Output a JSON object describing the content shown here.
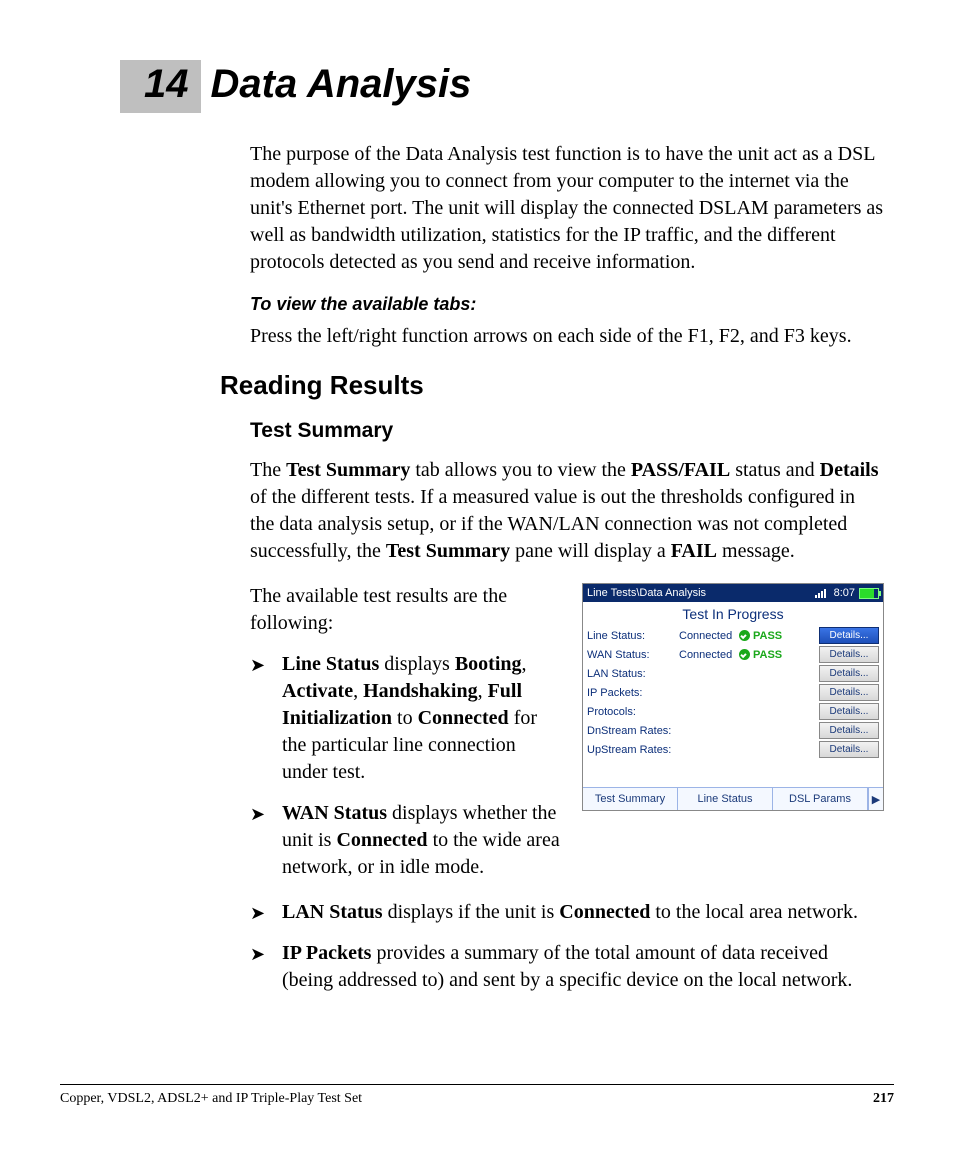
{
  "chapter": {
    "number": "14",
    "title": "Data Analysis"
  },
  "intro": "The purpose of the Data Analysis test function is to have the unit act as a DSL modem allowing you to connect from your computer to the internet via the unit's Ethernet port. The unit will display the connected DSLAM parameters as well as bandwidth utilization, statistics for the IP traffic, and the different protocols detected as you send and receive information.",
  "tabs_heading": "To view the available tabs:",
  "tabs_instruction": "Press the left/right function arrows on each side of the F1, F2, and F3 keys.",
  "h2": "Reading Results",
  "h3": "Test Summary",
  "summary_para_parts": {
    "a": "The ",
    "b": "Test Summary",
    "c": " tab allows you to view the ",
    "d": "PASS/FAIL",
    "e": " status and ",
    "f": "Details",
    "g": " of the different tests. If a measured value is out the thresholds configured in the data analysis setup, or if the WAN/LAN connection was not completed successfully, the ",
    "h": "Test Summary",
    "i": " pane will display a ",
    "j": "FAIL",
    "k": " message."
  },
  "avail_intro": "The available test results are the following:",
  "bullets_wrap": [
    {
      "parts": [
        "",
        "Line Status",
        " displays ",
        "Booting",
        ", ",
        "Activate",
        ", ",
        "Handshaking",
        ", ",
        "Full Initialization",
        " to ",
        "Connected",
        " for the particular line connection under test."
      ]
    },
    {
      "parts": [
        "",
        "WAN Status",
        " displays whether the unit is ",
        "Connected",
        " to the wide area network, or in idle mode."
      ]
    }
  ],
  "bullets_full": [
    {
      "parts": [
        "",
        "LAN Status",
        " displays if the unit is ",
        "Connected",
        " to the local area network."
      ]
    },
    {
      "parts": [
        "",
        "IP Packets",
        " provides a summary of the total amount of data received (being addressed to) and sent by a specific device on the local network."
      ]
    }
  ],
  "device": {
    "breadcrumb": "Line Tests\\Data Analysis",
    "clock": "8:07",
    "header": "Test In Progress",
    "rows": [
      {
        "label": "Line Status:",
        "value": "Connected",
        "pass": "PASS",
        "selected": true
      },
      {
        "label": "WAN Status:",
        "value": "Connected",
        "pass": "PASS",
        "selected": false
      },
      {
        "label": "LAN Status:",
        "value": "",
        "pass": "",
        "selected": false
      },
      {
        "label": "IP Packets:",
        "value": "",
        "pass": "",
        "selected": false
      },
      {
        "label": "Protocols:",
        "value": "",
        "pass": "",
        "selected": false
      },
      {
        "label": "DnStream Rates:",
        "value": "",
        "pass": "",
        "selected": false
      },
      {
        "label": "UpStream Rates:",
        "value": "",
        "pass": "",
        "selected": false
      }
    ],
    "button_label": "Details...",
    "tabs": [
      "Test Summary",
      "Line Status",
      "DSL Params"
    ],
    "scroll_glyph": "▶"
  },
  "footer": {
    "left": "Copper, VDSL2, ADSL2+ and IP Triple-Play Test Set",
    "page": "217"
  }
}
